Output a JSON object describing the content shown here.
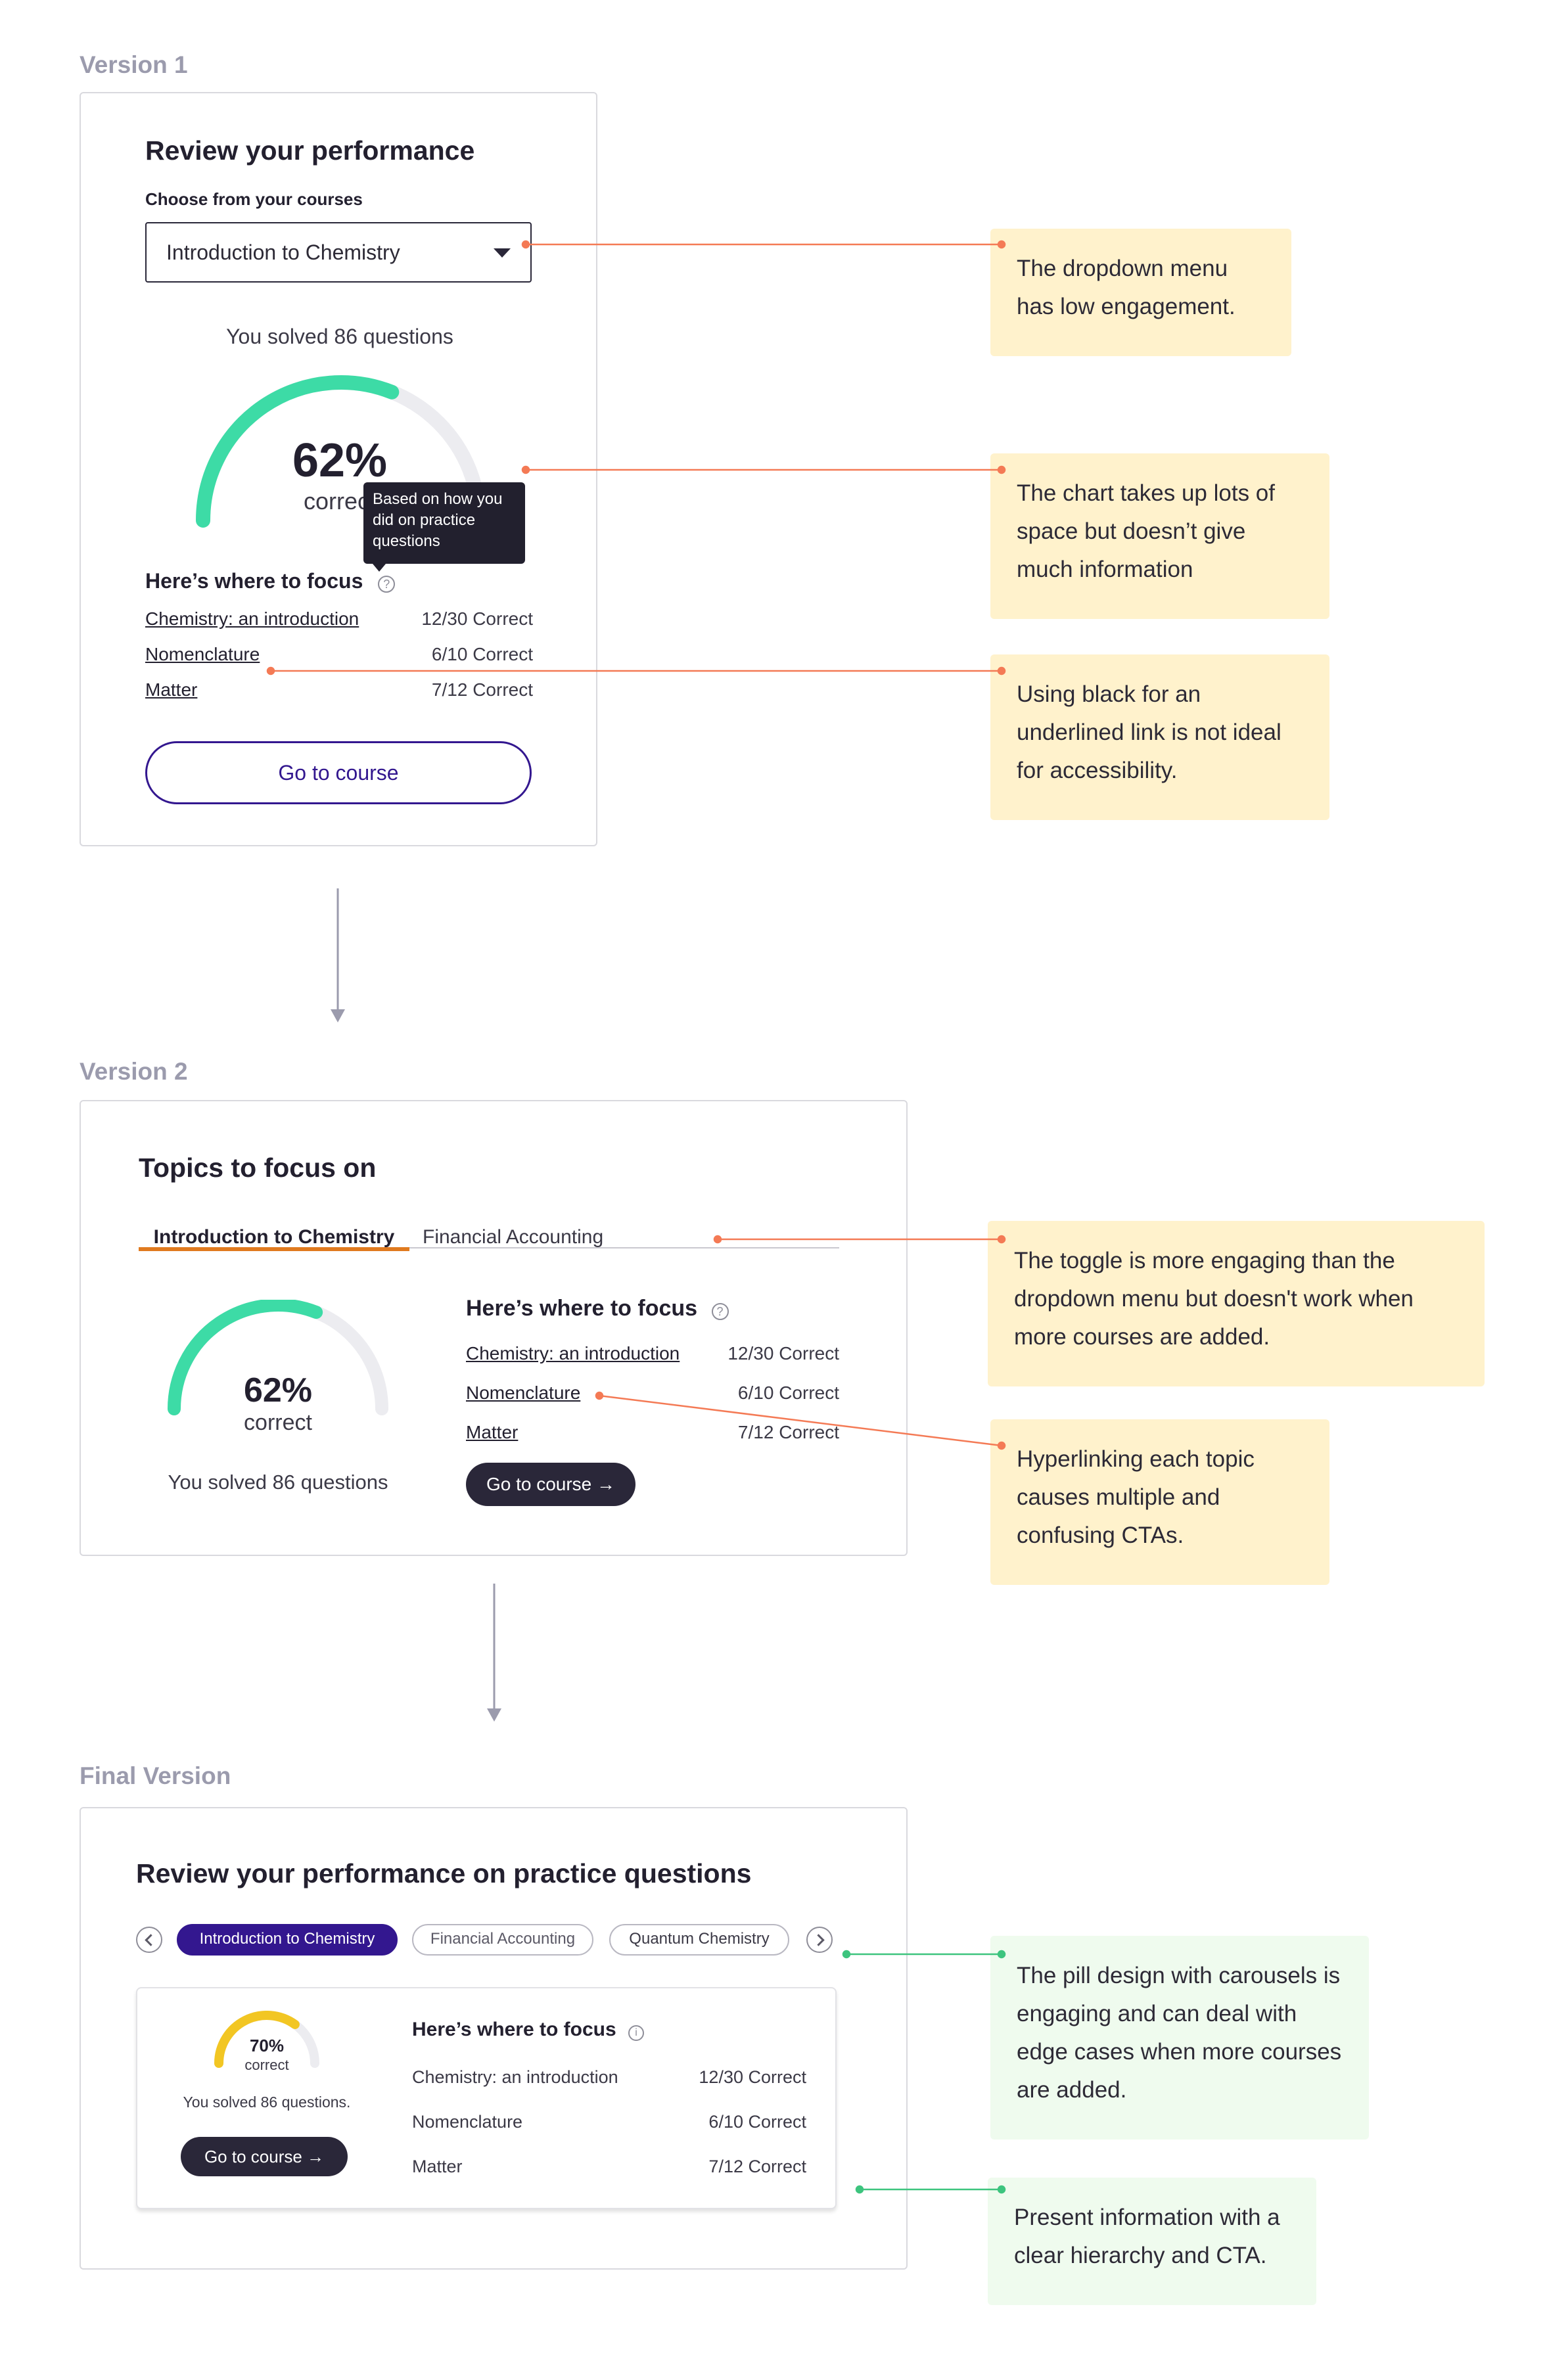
{
  "colors": {
    "accent_green": "#3ddba6",
    "accent_yellow": "#f2c623",
    "gauge_track": "#ececf0",
    "brand_purple": "#33178f",
    "tab_underline": "#e07a1f",
    "annotation_orange": "#f47a55",
    "annotation_green": "#3dc47e",
    "note_orange_bg": "#fff2cc",
    "note_green_bg": "#effbee"
  },
  "v1": {
    "label": "Version 1",
    "title": "Review your performance",
    "dropdown_label": "Choose from your courses",
    "dropdown_value": "Introduction to Chemistry",
    "solved": "You solved 86 questions",
    "gauge": {
      "percent": 62,
      "percent_text": "62%",
      "sub": "correct"
    },
    "tooltip": "Based on how you did on practice questions",
    "focus_heading": "Here’s where to focus",
    "topics": [
      {
        "name": "Chemistry: an introduction",
        "score": "12/30 Correct"
      },
      {
        "name": "Nomenclature",
        "score": "6/10 Correct"
      },
      {
        "name": "Matter",
        "score": "7/12 Correct"
      }
    ],
    "cta": "Go to course"
  },
  "v2": {
    "label": "Version 2",
    "title": "Topics to focus on",
    "tabs": [
      "Introduction to Chemistry",
      "Financial Accounting"
    ],
    "gauge": {
      "percent": 62,
      "percent_text": "62%",
      "sub": "correct"
    },
    "solved": "You solved 86 questions",
    "focus_heading": "Here’s where to focus",
    "topics": [
      {
        "name": "Chemistry: an introduction",
        "score": "12/30 Correct"
      },
      {
        "name": "Nomenclature",
        "score": "6/10 Correct"
      },
      {
        "name": "Matter",
        "score": "7/12 Correct"
      }
    ],
    "cta": "Go to course →"
  },
  "final": {
    "label": "Final Version",
    "title": "Review your performance on practice questions",
    "pills": [
      "Introduction to Chemistry",
      "Financial Accounting",
      "Quantum Chemistry"
    ],
    "gauge": {
      "percent": 70,
      "percent_text": "70%",
      "sub": "correct"
    },
    "solved": "You solved 86 questions.",
    "cta": "Go to course →",
    "focus_heading": "Here’s where to focus",
    "topics": [
      {
        "name": "Chemistry: an introduction",
        "score": "12/30 Correct"
      },
      {
        "name": "Nomenclature",
        "score": "6/10 Correct"
      },
      {
        "name": "Matter",
        "score": "7/12 Correct"
      }
    ]
  },
  "notes": {
    "n1": "The dropdown menu has low engagement.",
    "n2": "The chart takes up lots of space but doesn’t give much information",
    "n3": "Using black for an underlined link is not ideal for accessibility.",
    "n4": "The toggle is more engaging than the dropdown menu but doesn't work when more courses are added.",
    "n5": "Hyperlinking each topic causes multiple and confusing CTAs.",
    "n6": "The pill design with carousels is engaging and can deal with edge cases when more courses are added.",
    "n7": "Present information with a clear hierarchy and CTA."
  }
}
